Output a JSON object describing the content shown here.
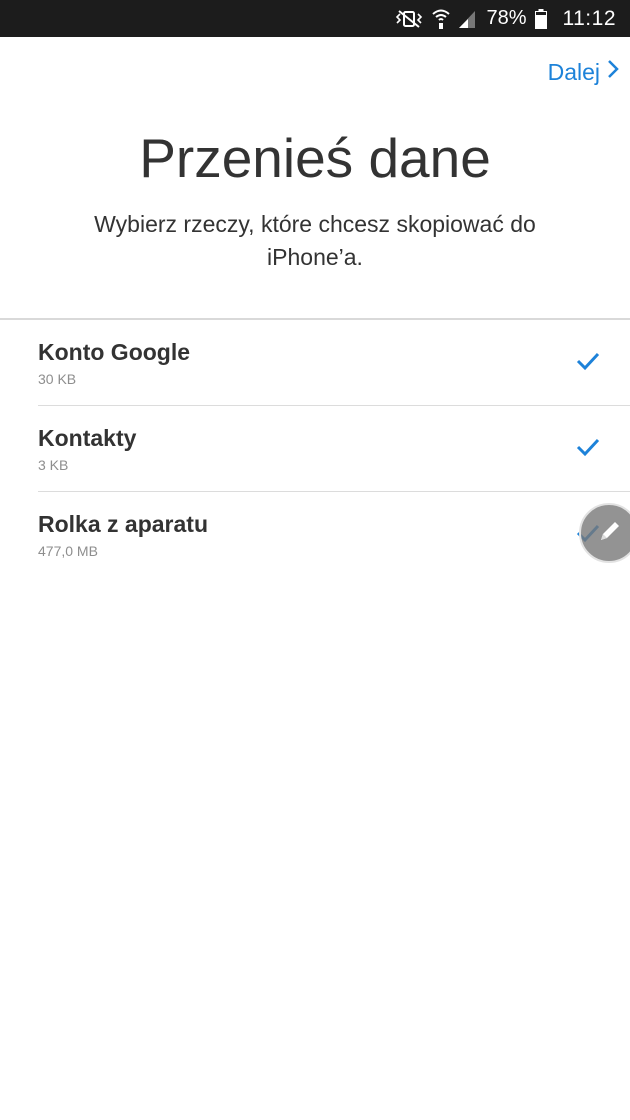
{
  "status_bar": {
    "battery_percent": "78%",
    "time": "11:12",
    "icons": [
      "vibrate-mute-icon",
      "wifi-icon",
      "signal-icon",
      "battery-icon"
    ]
  },
  "header": {
    "next_label": "Dalej"
  },
  "main": {
    "title": "Przenieś dane",
    "subtitle": "Wybierz rzeczy, które chcesz skopiować do iPhone’a."
  },
  "items": [
    {
      "title": "Konto Google",
      "size": "30 KB",
      "checked": true
    },
    {
      "title": "Kontakty",
      "size": "3 KB",
      "checked": true
    },
    {
      "title": "Rolka z aparatu",
      "size": "477,0 MB",
      "checked": true
    }
  ],
  "colors": {
    "accent": "#1d82d9",
    "status_bar_bg": "#1c1c1c",
    "text": "#333333",
    "secondary_text": "#8e8e8e"
  }
}
